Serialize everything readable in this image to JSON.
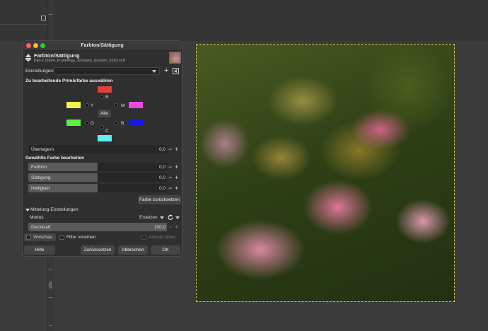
{
  "dialog": {
    "window_title": "Farbton/Sättigung",
    "heading": "Farbton/Sättigung",
    "subtitle": "Bild-2 (2604_Fruehlings_knospen_blueten_0182.xcf)",
    "presets_label": "Einstellungen:",
    "primary_section": "Zu bearbeitende Primärfarbe auswählen",
    "colors": {
      "R": "#e2403e",
      "Y": "#f6f04a",
      "M": "#e84ae2",
      "G": "#62ef43",
      "B": "#1a17ee",
      "C": "#63eef2"
    },
    "color_letters": {
      "R": "R",
      "Y": "Y",
      "M": "M",
      "G": "G",
      "B": "B",
      "C": "C"
    },
    "all_button": "Alle",
    "overlap": {
      "label": "Überlagern",
      "value": "0,0"
    },
    "edit_section": "Gewählte Farbe bearbeiten",
    "hue": {
      "label": "Farbton",
      "value": "0,0"
    },
    "saturation": {
      "label": "Sättigung",
      "value": "0,0"
    },
    "lightness": {
      "label": "Helligkeit",
      "value": "0,0"
    },
    "reset_color_button": "Farbe zurücksetzen",
    "blending_section": "Mittelung-Einstellungen",
    "mode": {
      "label": "Modus",
      "value": "Ersetzen"
    },
    "opacity": {
      "label": "Deckkraft",
      "value": "100,0",
      "fraction": 1.0
    },
    "preview_label": "Vorschau",
    "merge_filter_label": "Filter vereinen",
    "split_view_label": "Ansicht teilen",
    "help_button": "Hilfe",
    "reset_button": "Zurücksetzen",
    "cancel_button": "Abbrechen",
    "ok_button": "OK"
  },
  "ruler": {
    "label": "200"
  }
}
